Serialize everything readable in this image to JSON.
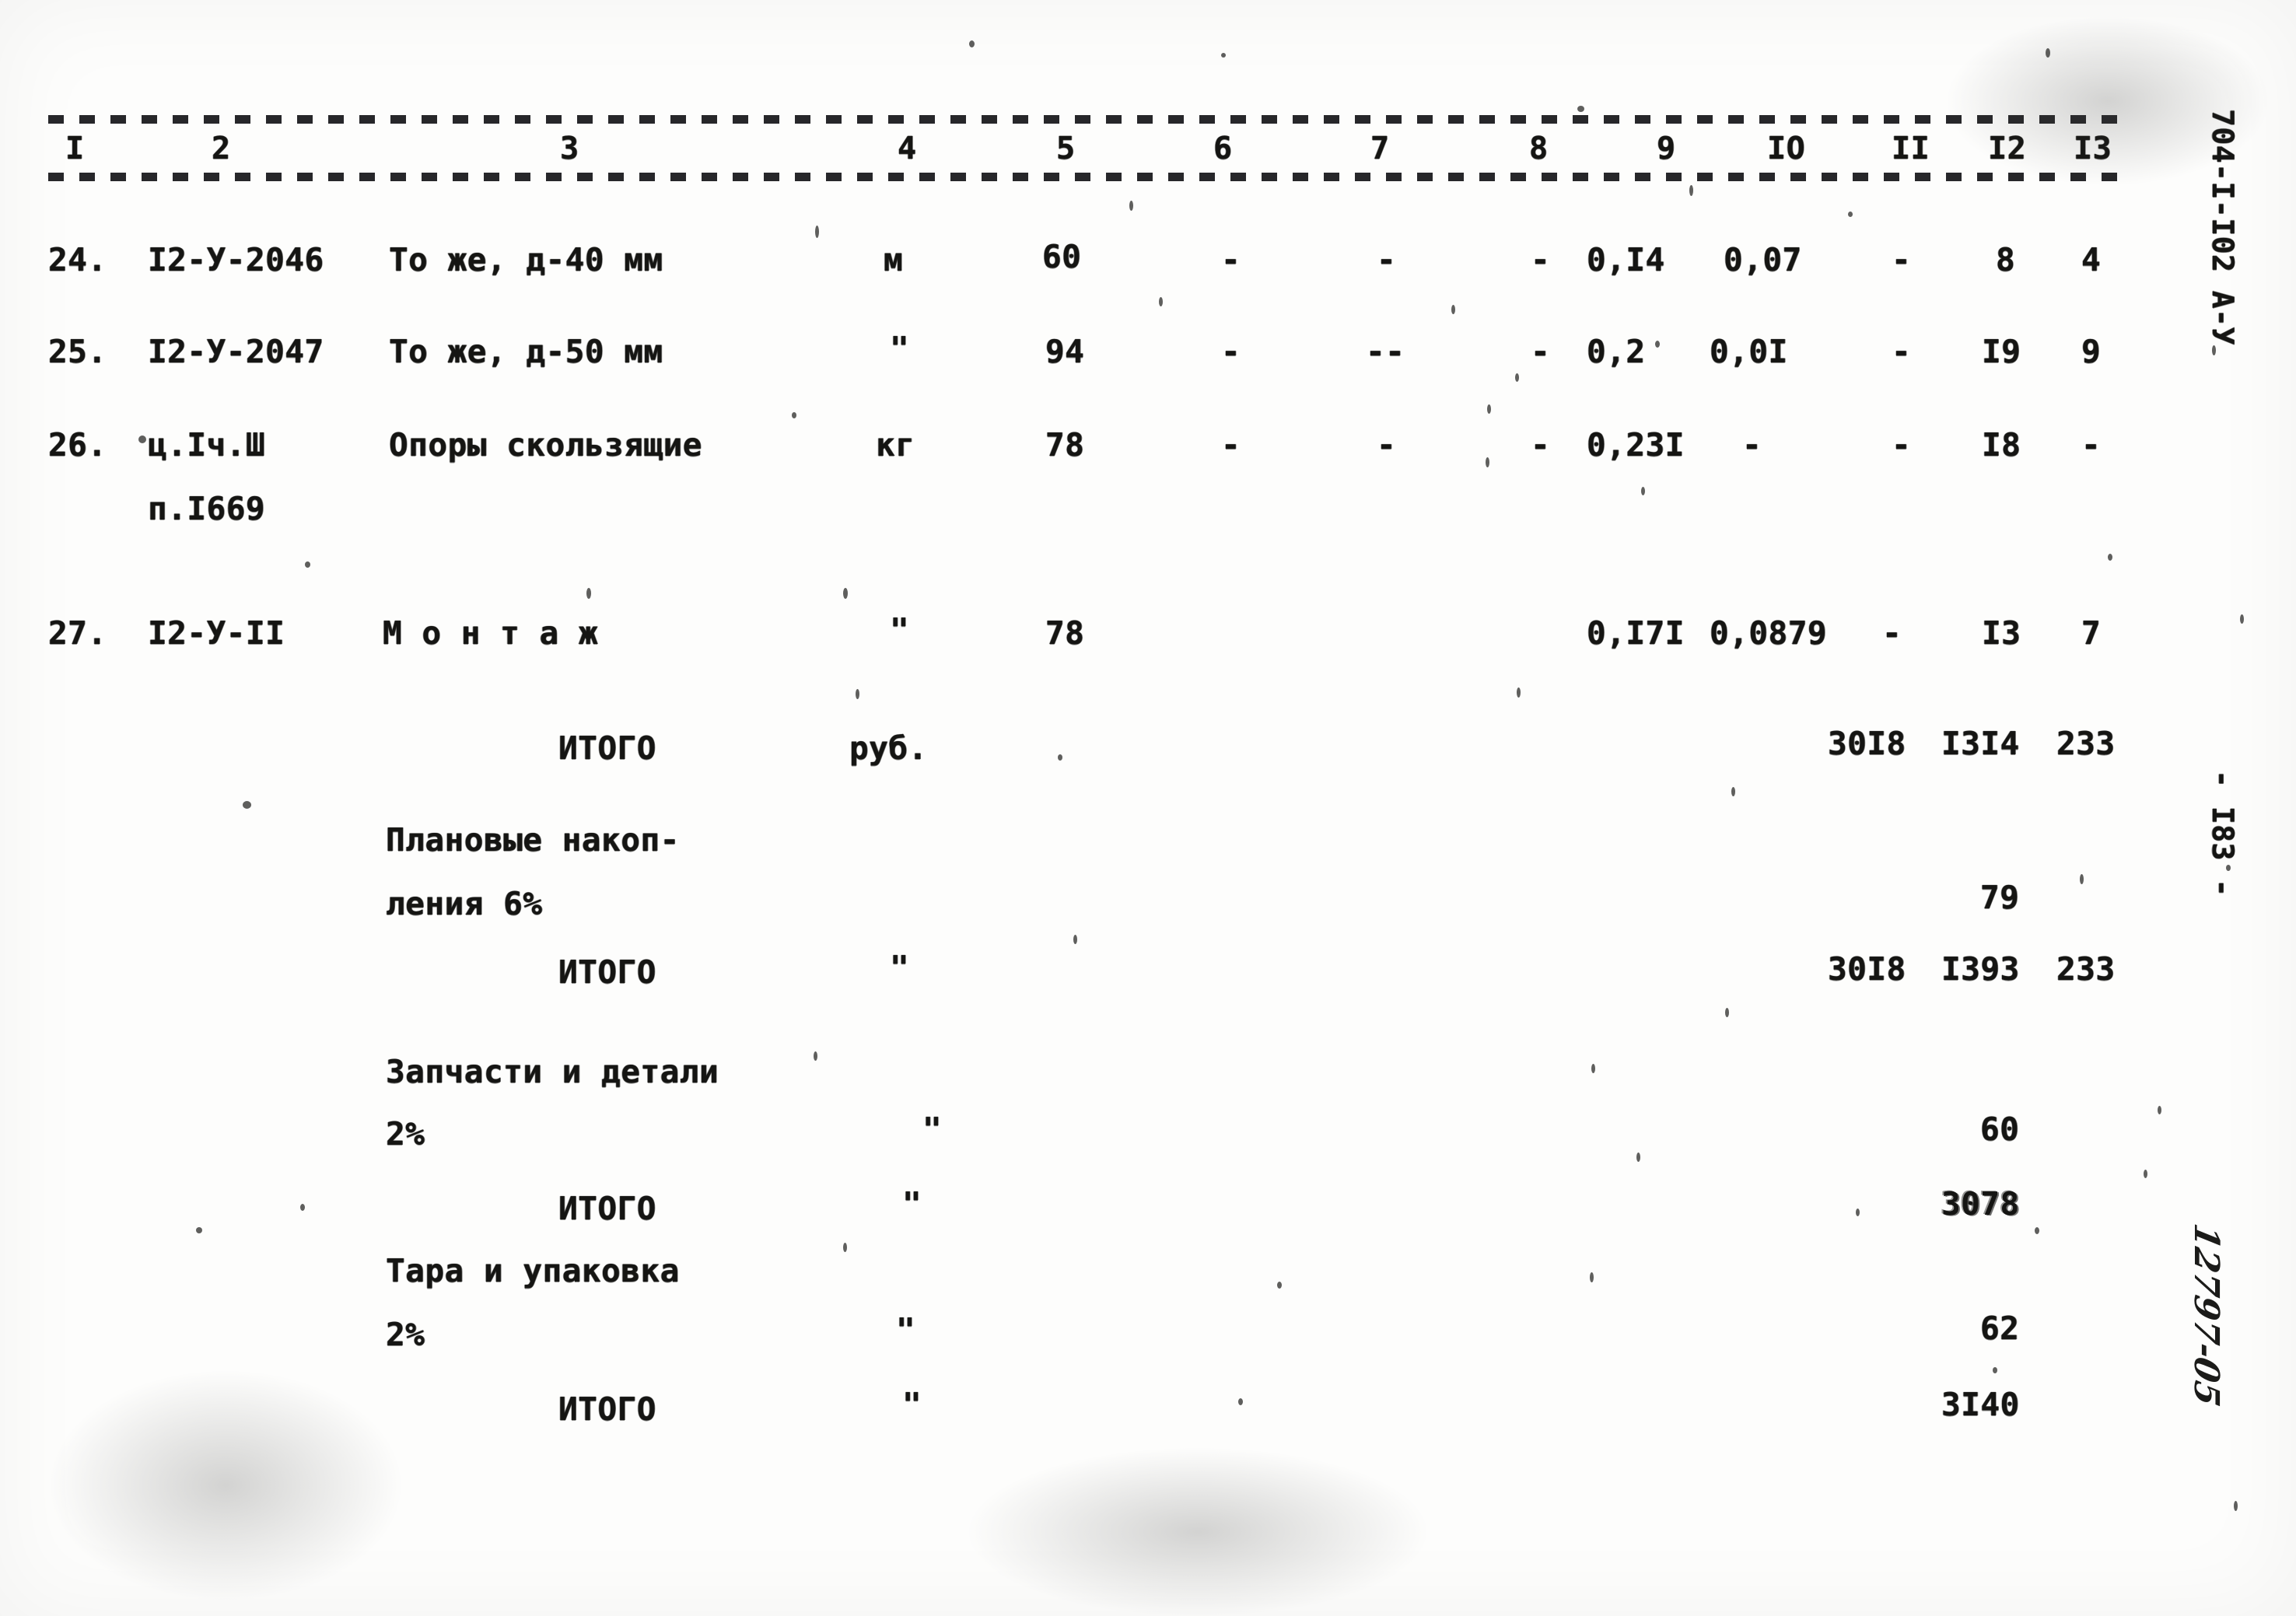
{
  "document": {
    "kind": "scanned-typewritten-estimate-table",
    "margin_right_top": "704-I-I02  А-У",
    "margin_right_page": "- I83 -",
    "margin_right_handwritten": "12797-05"
  },
  "table": {
    "column_numbers": [
      "I",
      "2",
      "3",
      "4",
      "5",
      "6",
      "7",
      "8",
      "9",
      "IO",
      "II",
      "I2",
      "I3"
    ],
    "rows": [
      {
        "num": "24.",
        "code": "I2-У-2046",
        "name": "То же, д-40 мм",
        "unit": "м",
        "qty": "60",
        "c6": "-",
        "c7": "-",
        "c8": "-",
        "c9": "0,I4",
        "c10": "0,07",
        "c11": "-",
        "c12": "8",
        "c13": "4"
      },
      {
        "num": "25.",
        "code": "I2-У-2047",
        "name": "То же, д-50 мм",
        "unit": "\"",
        "qty": "94",
        "c6": "-",
        "c7": "--",
        "c8": "-",
        "c9": "0,2",
        "c10": "0,0I",
        "c11": "-",
        "c12": "I9",
        "c13": "9"
      },
      {
        "num": "26.",
        "code": "ц.Iч.Ш",
        "code2": "п.I669",
        "name": "Опоры скользящие",
        "unit": "кг",
        "qty": "78",
        "c6": "-",
        "c7": "-",
        "c8": "-",
        "c9": "0,23I",
        "c10": "-",
        "c11": "-",
        "c12": "I8",
        "c13": "-"
      },
      {
        "num": "27.",
        "code": "I2-У-II",
        "name": "М о н т а ж",
        "unit": "\"",
        "qty": "78",
        "c6": "",
        "c7": "",
        "c8": "",
        "c9": "0,I7I",
        "c10": "0,0879",
        "c11": "-",
        "c12": "I3",
        "c13": "7"
      }
    ],
    "summary": [
      {
        "label": "ИТОГО",
        "unit": "руб.",
        "v11": "30I8",
        "v12": "I3I4",
        "v13": "233"
      },
      {
        "label_line1": "Плановые накоп-",
        "label_line2": "ления 6%",
        "unit": "",
        "v11": "",
        "v12": "79",
        "v13": ""
      },
      {
        "label": "ИТОГО",
        "unit": "\"",
        "v11": "30I8",
        "v12": "I393",
        "v13": "233"
      },
      {
        "label_line1": "Запчасти и детали",
        "label_line2": "2%",
        "unit": "\"",
        "v11": "",
        "v12": "60",
        "v13": ""
      },
      {
        "label": "ИТОГО",
        "unit": "\"",
        "v11": "",
        "v12": "3078",
        "v13": ""
      },
      {
        "label_line1": "Тара и упаковка",
        "label_line2": "2%",
        "unit": "\"",
        "v11": "",
        "v12": "62",
        "v13": ""
      },
      {
        "label": "ИТОГО",
        "unit": "\"",
        "v11": "",
        "v12": "3I40",
        "v13": ""
      }
    ]
  }
}
